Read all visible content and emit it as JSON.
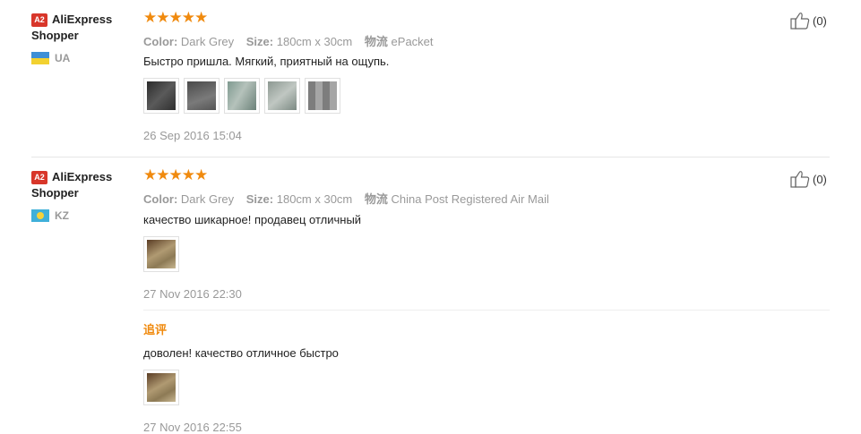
{
  "feedbacks": [
    {
      "buyer": {
        "level": "A2",
        "name": "AliExpress Shopper",
        "country": "UA",
        "flag_icon": "ukraine-flag-icon"
      },
      "rating_stars": "★★★★★",
      "rating": 5,
      "attributes": [
        {
          "key": "Color:",
          "value": "Dark Grey"
        },
        {
          "key": "Size:",
          "value": "180cm x 30cm"
        },
        {
          "key": "物流",
          "value": "ePacket"
        }
      ],
      "text": "Быстро пришла. Мягкий, приятный на ощупь.",
      "photos": [
        {
          "name": "photo-dark-scarf-icon",
          "color": "#3a3a3a"
        },
        {
          "name": "photo-grey-packaging-icon",
          "color": "#6b6b6b"
        },
        {
          "name": "photo-scarf-folds-icon",
          "color": "#8fa39a"
        },
        {
          "name": "photo-scarf-texture-icon",
          "color": "#9aa59e"
        },
        {
          "name": "photo-plaid-scarf-icon",
          "color": "#8c8c8c"
        }
      ],
      "date": "26 Sep 2016 15:04",
      "useful": {
        "icon": "thumbs-up-icon",
        "count": "(0)"
      }
    },
    {
      "buyer": {
        "level": "A2",
        "name": "AliExpress Shopper",
        "country": "KZ",
        "flag_icon": "kazakhstan-flag-icon"
      },
      "rating_stars": "★★★★★",
      "rating": 5,
      "attributes": [
        {
          "key": "Color:",
          "value": "Dark Grey"
        },
        {
          "key": "Size:",
          "value": "180cm x 30cm"
        },
        {
          "key": "物流",
          "value": "China Post Registered Air Mail"
        }
      ],
      "text": "качество шикарное! продавец отличный",
      "photos": [
        {
          "name": "photo-scarf-worn-icon",
          "color": "#a08a6a"
        }
      ],
      "date": "27 Nov 2016 22:30",
      "useful": {
        "icon": "thumbs-up-icon",
        "count": "(0)"
      },
      "additional": {
        "label": "追评",
        "text": "доволен! качество отличное быстро",
        "photos": [
          {
            "name": "photo-scarf-worn-icon",
            "color": "#a08a6a"
          }
        ],
        "date": "27 Nov 2016 22:55"
      }
    }
  ]
}
